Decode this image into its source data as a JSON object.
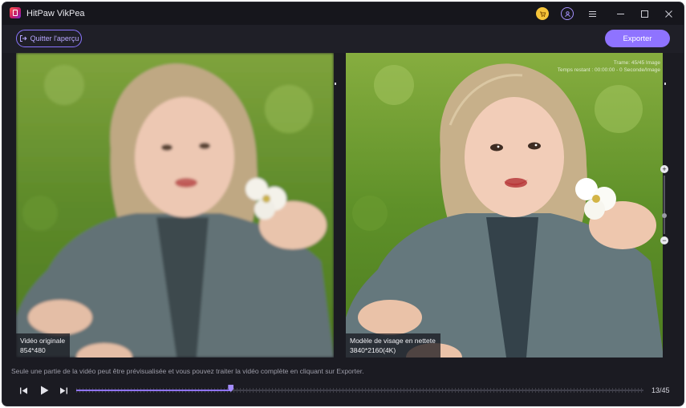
{
  "app": {
    "title": "HitPaw VikPea"
  },
  "titlebar": {
    "icons": [
      "cart-icon",
      "user-icon",
      "menu-icon",
      "minimize-icon",
      "maximize-icon",
      "close-icon"
    ]
  },
  "toolbar": {
    "quit_label": "Quitter l'aperçu",
    "export_label": "Exporter"
  },
  "left_panel": {
    "label": "Vidéo originale",
    "resolution": "854*480"
  },
  "right_panel": {
    "label": "Modèle de visage en nettete",
    "resolution": "3840*2160(4K)",
    "info_line1": "Trame: 45/45 Image",
    "info_line2": "Temps restant : 00:00:00 - 0 Seconde/Image"
  },
  "zoom": {
    "plus": "+",
    "minus": "−"
  },
  "notice": "Seule une partie de la vidéo peut être prévisualisée et vous pouvez traiter la vidéo complète en cliquant sur Exporter.",
  "playback": {
    "frame_counter": "13/45",
    "current_frame": 13,
    "total_frames": 45
  },
  "colors": {
    "accent": "#8f73ff",
    "window_bg": "#1b1b22",
    "titlebar_bg": "#16161c"
  }
}
